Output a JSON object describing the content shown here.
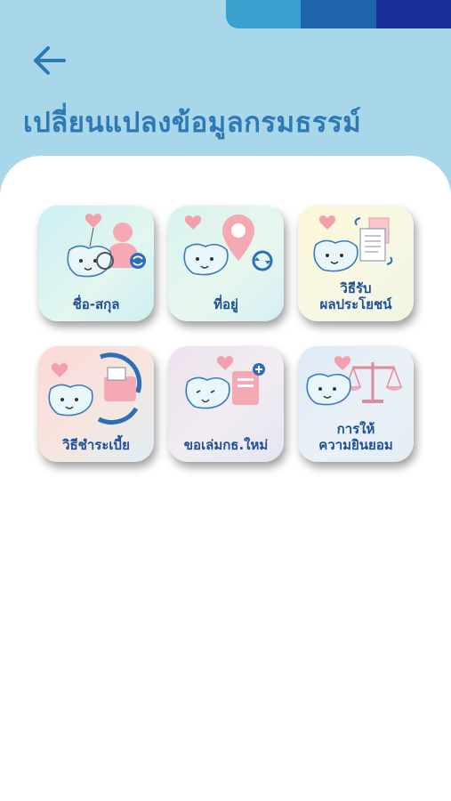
{
  "colors": {
    "background": "#a9d7ea",
    "title": "#2e79b5",
    "label": "#1d4f9a",
    "stripes": [
      "#3aa0cf",
      "#1f64ad",
      "#1a2e9a"
    ]
  },
  "header": {
    "back_icon": "arrow-left-icon",
    "title": "เปลี่ยนแปลงข้อมูลกรมธรรม์"
  },
  "menu": [
    {
      "id": "name",
      "label": "ชื่อ-สกุล",
      "icon": "person-swap-icon"
    },
    {
      "id": "address",
      "label": "ที่อยู่",
      "icon": "location-pin-icon"
    },
    {
      "id": "benefit",
      "label": "วิธีรับ\nผลประโยชน์",
      "icon": "document-exchange-icon"
    },
    {
      "id": "payment",
      "label": "วิธีชำระเบี้ย",
      "icon": "wallet-cycle-icon"
    },
    {
      "id": "new_book",
      "label": "ขอเล่มกธ.ใหม่",
      "icon": "new-book-icon"
    },
    {
      "id": "consent",
      "label": "การให้\nความยินยอม",
      "icon": "scale-icon"
    }
  ]
}
